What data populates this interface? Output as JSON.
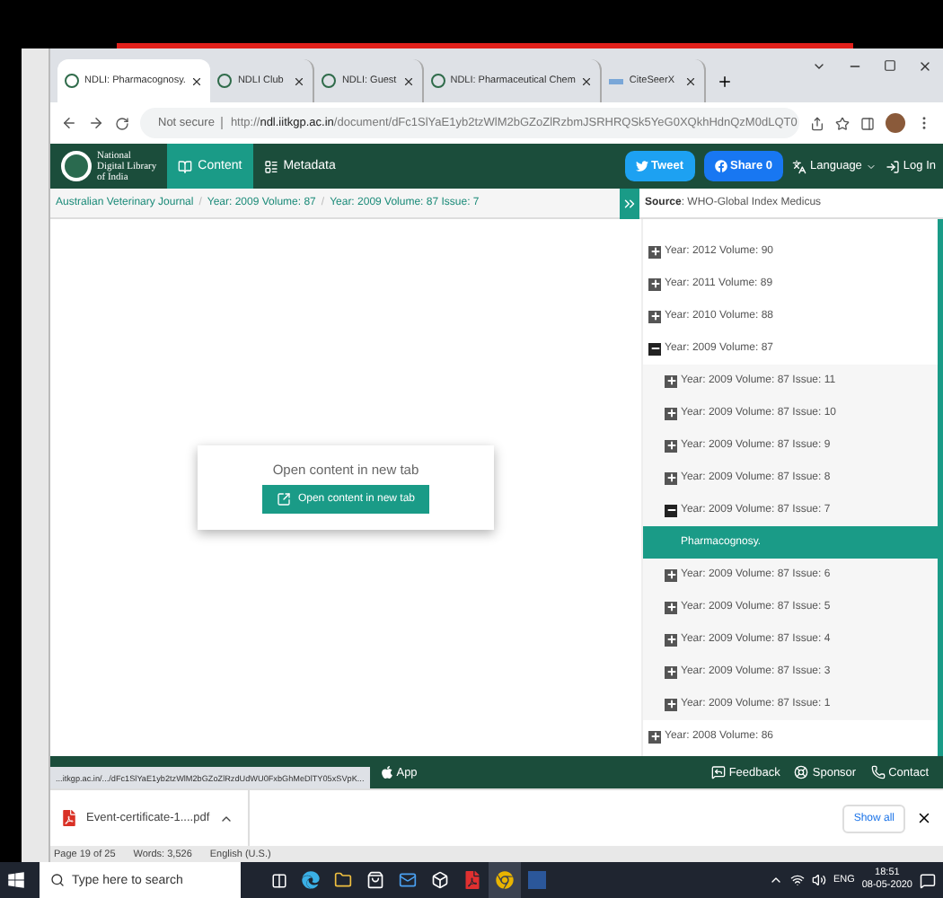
{
  "browser": {
    "tabs": [
      {
        "kind": "ndli",
        "title": "NDLI: Pharmacognosy.",
        "selected": true
      },
      {
        "kind": "ndli",
        "title": "NDLI Club",
        "selected": false
      },
      {
        "kind": "ndli",
        "title": "NDLI: Guest",
        "selected": false
      },
      {
        "kind": "ndli",
        "title": "NDLI: Pharmaceutical Chem",
        "selected": false
      },
      {
        "kind": "citeseer",
        "title": "CiteSeerX",
        "selected": false
      }
    ],
    "security": "Not secure",
    "url": "http://**ndl.iitkgp.ac.in**/document/dFc1SlYaE1yb2tzWlM2bGZoZlRzbmJSRHRQSk5YeG0XQkhHdnQzM0dLQT0"
  },
  "header": {
    "logo_lines": [
      "National",
      "Digital Library",
      "of India"
    ],
    "nav": [
      {
        "label": "Content",
        "selected": true
      },
      {
        "label": "Metadata",
        "selected": false
      }
    ],
    "tweet": "Tweet",
    "share": "Share 0",
    "language": "Language",
    "login": "Log In"
  },
  "breadcrumb": {
    "separator": "/",
    "items": [
      "Australian Veterinary Journal",
      "Year: 2009 Volume: 87",
      "Year: 2009 Volume: 87 Issue: 7"
    ]
  },
  "source": {
    "label": "Source",
    "value": ": WHO-Global Index Medicus"
  },
  "tree": [
    {
      "label": "Year: 2012 Volume: 90",
      "expanded": false,
      "selected": false
    },
    {
      "label": "Year: 2011 Volume: 89",
      "expanded": false,
      "selected": false
    },
    {
      "label": "Year: 2010 Volume: 88",
      "expanded": false,
      "selected": false
    },
    {
      "label": "Year: 2009 Volume: 87",
      "expanded": true,
      "selected": false,
      "children": [
        {
          "label": "Year: 2009 Volume: 87 Issue: 11",
          "expanded": false,
          "selected": false
        },
        {
          "label": "Year: 2009 Volume: 87 Issue: 10",
          "expanded": false,
          "selected": false
        },
        {
          "label": "Year: 2009 Volume: 87 Issue: 9",
          "expanded": false,
          "selected": false
        },
        {
          "label": "Year: 2009 Volume: 87 Issue: 8",
          "expanded": false,
          "selected": false
        },
        {
          "label": "Year: 2009 Volume: 87 Issue: 7",
          "expanded": true,
          "selected": false,
          "children": [
            {
              "label": "Pharmacognosy.",
              "selected": true
            }
          ]
        },
        {
          "label": "Year: 2009 Volume: 87 Issue: 6",
          "expanded": false,
          "selected": false
        },
        {
          "label": "Year: 2009 Volume: 87 Issue: 5",
          "expanded": false,
          "selected": false
        },
        {
          "label": "Year: 2009 Volume: 87 Issue: 4",
          "expanded": false,
          "selected": false
        },
        {
          "label": "Year: 2009 Volume: 87 Issue: 3",
          "expanded": false,
          "selected": false
        },
        {
          "label": "Year: 2009 Volume: 87 Issue: 1",
          "expanded": false,
          "selected": false
        }
      ]
    },
    {
      "label": "Year: 2008 Volume: 86",
      "expanded": false,
      "selected": false
    }
  ],
  "dialog": {
    "message": "Open content in new tab",
    "button": "Open content in new tab"
  },
  "footer": {
    "status_url": "...itkgp.ac.in/.../dFc1SlYaE1yb2tzWlM2bGZoZlRzdUdWU0FxbGhMeDlTY05xSVpK...",
    "app": "App",
    "links": [
      "Feedback",
      "Sponsor",
      "Contact"
    ]
  },
  "downloads": {
    "file": "Event-certificate-1....pdf",
    "show_all": "Show all"
  },
  "word_status": [
    "Page 19 of 25",
    "Words: 3,526",
    "English (U.S.)"
  ],
  "taskbar": {
    "search_placeholder": "Type here to search",
    "language": "ENG",
    "time": "18:51",
    "date": "08-05-2020"
  }
}
